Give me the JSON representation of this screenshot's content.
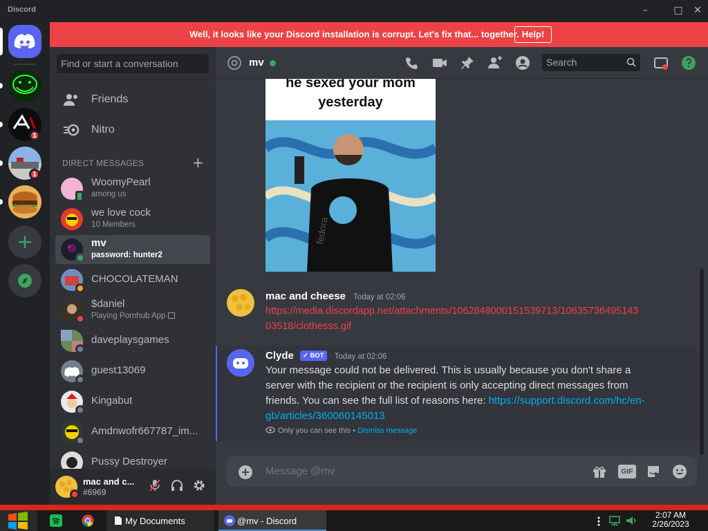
{
  "window": {
    "title": "Discord"
  },
  "banner": {
    "text": "Well, it looks like your Discord installation is corrupt. Let's fix that... together.",
    "help_label": "Help!",
    "color": "#ed4245"
  },
  "guilds": {
    "badges": [
      "1",
      "1"
    ]
  },
  "sidebar": {
    "search_placeholder": "Find or start a conversation",
    "nav": [
      {
        "label": "Friends"
      },
      {
        "label": "Nitro"
      }
    ],
    "dm_header": "DIRECT MESSAGES",
    "dms": [
      {
        "name": "WoomyPearl",
        "sub": "among us"
      },
      {
        "name": "we love cock",
        "sub": "10 Members"
      },
      {
        "name": "mv",
        "sub": "password: hunter2"
      },
      {
        "name": "CHOCOLATEMAN"
      },
      {
        "name": "$daniel",
        "sub": "Playing Pornhub App"
      },
      {
        "name": "daveplaysgames"
      },
      {
        "name": "guest13069"
      },
      {
        "name": "Kingabut"
      },
      {
        "name": "Amdnwofr667787_im..."
      },
      {
        "name": "Pussy Destroyer"
      }
    ]
  },
  "user_panel": {
    "name": "mac and c...",
    "tag": "#6969"
  },
  "chat": {
    "channel": "mv",
    "search_placeholder": "Search",
    "meme_caption_1": "he sexed your mom",
    "meme_caption_2": "yesterday",
    "meme_shirt": "fedora",
    "messages": [
      {
        "author": "mac and cheese",
        "time": "Today at 02:06",
        "link_line_1": "https://media.discordapp.net/attachments/1062848000151539713/10635736495143",
        "link_line_2": "03518/clothesss.gif"
      },
      {
        "author": "Clyde",
        "bot_tag": "✓ BOT",
        "time": "Today at 02:06",
        "line_1": "Your message could not be delivered. This is usually because you don't share a",
        "line_2": "server with the recipient or the recipient is only accepting direct messages from",
        "line_3": "friends. You can see the full list of reasons here: ",
        "link_a": "https://support.discord.com/hc/en-",
        "link_b": "gb/articles/360060145013",
        "ephemeral": "Only you can see this • ",
        "dismiss": "Dismiss message"
      }
    ],
    "composer_placeholder": "Message @mv",
    "gif_label": "GIF"
  },
  "taskbar": {
    "items": [
      {
        "label": "My Documents"
      },
      {
        "label": "@mv - Discord"
      }
    ],
    "time": "2:07 AM",
    "date": "2/26/2023"
  }
}
